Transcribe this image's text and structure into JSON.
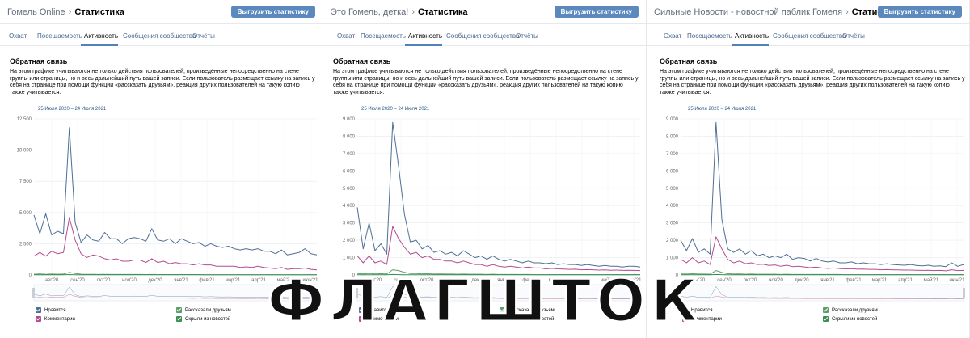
{
  "colors": {
    "likes": "#4e6f95",
    "comments": "#b44c8f",
    "reposts": "#5f9c6b",
    "hidden": "#3a8f52",
    "accent": "#5181b8",
    "button": "#5b88bd"
  },
  "panels": [
    {
      "group_name": "Гомель Online",
      "page_title": "Статистика",
      "export_label": "Выгрузить статистику",
      "tabs": [
        {
          "label": "Охват"
        },
        {
          "label": "Посещаемость"
        },
        {
          "label": "Активность"
        },
        {
          "label": "Сообщения сообщества"
        },
        {
          "label": "Отчёты"
        }
      ],
      "active_tab": 2,
      "section_title": "Обратная связь",
      "description": "На этом графике учитываются не только действия пользователей, произведённые непосредственно на стене группы или страницы, но и весь дальнейший путь вашей записи. Если пользователь размещает ссылку на запись у себя на странице при помощи функции «рассказать друзьям», реакция других пользователей на такую копию также учитывается.",
      "date_range": "25 Июля 2020 – 24 Июля 2021",
      "legend": {
        "likes": "Нравится",
        "comments": "Комментарии",
        "reposts": "Рассказали друзьям",
        "hidden": "Скрыли из новостей"
      },
      "chart_data": {
        "type": "line",
        "y_ticks": [
          "12 500",
          "10 000",
          "7 500",
          "5 000",
          "2 500",
          "0"
        ],
        "ylim": [
          0,
          12500
        ],
        "x_ticks": [
          "авг'20",
          "сен'20",
          "окт'20",
          "ноя'20",
          "дек'20",
          "янв'21",
          "фев'21",
          "мар'21",
          "апр'21",
          "май'21",
          "июн'21"
        ],
        "series": [
          {
            "name": "Нравится",
            "key": "likes",
            "values": [
              4800,
              3300,
              4900,
              3200,
              3500,
              3300,
              11800,
              4200,
              2600,
              3200,
              2800,
              2700,
              3400,
              2900,
              2900,
              2500,
              2900,
              3000,
              2900,
              2700,
              3700,
              2800,
              2700,
              2900,
              2500,
              2900,
              2700,
              2500,
              2600,
              2300,
              2500,
              2300,
              2200,
              2300,
              2100,
              2000,
              2100,
              2000,
              2100,
              1900,
              1900,
              1700,
              2000,
              1600,
              1700,
              1800,
              2100,
              1700,
              1600
            ]
          },
          {
            "name": "Комментарии",
            "key": "comments",
            "values": [
              1500,
              1800,
              1500,
              1900,
              1700,
              1800,
              4600,
              2800,
              1700,
              1400,
              1600,
              1500,
              1300,
              1200,
              1300,
              1100,
              1100,
              1200,
              1200,
              1000,
              1300,
              1000,
              1100,
              900,
              1000,
              900,
              900,
              800,
              900,
              800,
              800,
              700,
              700,
              700,
              700,
              600,
              650,
              600,
              700,
              600,
              550,
              500,
              600,
              450,
              500,
              500,
              550,
              450,
              400
            ]
          },
          {
            "name": "Рассказали друзьям",
            "key": "reposts",
            "values": [
              60,
              80,
              50,
              70,
              60,
              70,
              200,
              120,
              60,
              50,
              50,
              40,
              50,
              40,
              40,
              40,
              40,
              40,
              40,
              30,
              40,
              30,
              30,
              30,
              30,
              30,
              30,
              30,
              30,
              20,
              20,
              20,
              20,
              20,
              20,
              20,
              20,
              20,
              20,
              20,
              20,
              20,
              20,
              20,
              20,
              20,
              20,
              20,
              20
            ]
          },
          {
            "name": "Скрыли из новостей",
            "key": "hidden",
            "values": [
              10,
              10,
              10,
              10,
              10,
              10,
              30,
              20,
              10,
              10,
              10,
              10,
              10,
              10,
              10,
              10,
              10,
              10,
              10,
              10,
              10,
              10,
              10,
              10,
              10,
              10,
              10,
              10,
              10,
              10,
              10,
              10,
              10,
              10,
              10,
              10,
              10,
              10,
              10,
              10,
              10,
              10,
              10,
              10,
              10,
              10,
              10,
              10,
              10
            ]
          }
        ]
      }
    },
    {
      "group_name": "Это Гомель, детка!",
      "page_title": "Статистика",
      "export_label": "Выгрузить статистику",
      "tabs": [
        {
          "label": "Охват"
        },
        {
          "label": "Посещаемость"
        },
        {
          "label": "Активность"
        },
        {
          "label": "Сообщения сообщества"
        },
        {
          "label": "Отчёты"
        }
      ],
      "active_tab": 2,
      "section_title": "Обратная связь",
      "description": "На этом графике учитываются не только действия пользователей, произведённые непосредственно на стене группы или страницы, но и весь дальнейший путь вашей записи. Если пользователь размещает ссылку на запись у себя на странице при помощи функции «рассказать друзьям», реакция других пользователей на такую копию также учитывается.",
      "date_range": "25 Июля 2020 – 24 Июля 2021",
      "legend": {
        "likes": "Нравится",
        "comments": "Комментарии",
        "reposts": "Рассказали друзьям",
        "hidden": "Скрыли из новостей"
      },
      "chart_data": {
        "type": "line",
        "y_ticks": [
          "9 000",
          "8 000",
          "7 000",
          "6 000",
          "5 000",
          "4 000",
          "3 000",
          "2 000",
          "1 000",
          "0"
        ],
        "ylim": [
          0,
          9000
        ],
        "x_ticks": [
          "авг'20",
          "сен'20",
          "окт'20",
          "ноя'20",
          "дек'20",
          "янв'21",
          "фев'21",
          "мар'21",
          "апр'21",
          "май'21",
          "июн'21"
        ],
        "series": [
          {
            "name": "Нравится",
            "key": "likes",
            "values": [
              3900,
              1500,
              3000,
              1400,
              1800,
              1200,
              8800,
              6300,
              3500,
              1900,
              2000,
              1500,
              1700,
              1300,
              1400,
              1200,
              1300,
              1100,
              1400,
              1200,
              1000,
              1100,
              900,
              1100,
              900,
              800,
              900,
              800,
              700,
              800,
              700,
              700,
              650,
              700,
              600,
              650,
              600,
              600,
              550,
              600,
              550,
              500,
              550,
              500,
              500,
              450,
              500,
              500,
              450
            ]
          },
          {
            "name": "Комментарии",
            "key": "comments",
            "values": [
              1100,
              700,
              1100,
              700,
              800,
              600,
              2800,
              2100,
              1600,
              1200,
              1300,
              1000,
              1100,
              900,
              900,
              800,
              800,
              700,
              800,
              700,
              600,
              600,
              500,
              600,
              500,
              450,
              500,
              450,
              400,
              450,
              400,
              400,
              350,
              380,
              350,
              340,
              320,
              330,
              300,
              310,
              300,
              280,
              290,
              270,
              280,
              260,
              270,
              260,
              250
            ]
          },
          {
            "name": "Рассказали друзьям",
            "key": "reposts",
            "values": [
              80,
              60,
              90,
              60,
              70,
              50,
              300,
              250,
              150,
              80,
              80,
              60,
              70,
              50,
              60,
              50,
              50,
              40,
              50,
              40,
              40,
              40,
              30,
              40,
              30,
              30,
              30,
              30,
              30,
              30,
              20,
              20,
              20,
              20,
              20,
              20,
              20,
              20,
              20,
              20,
              20,
              20,
              20,
              20,
              20,
              20,
              20,
              20,
              20
            ]
          },
          {
            "name": "Скрыли из новостей",
            "key": "hidden",
            "values": [
              10,
              10,
              10,
              10,
              10,
              10,
              30,
              20,
              10,
              10,
              10,
              10,
              10,
              10,
              10,
              10,
              10,
              10,
              10,
              10,
              10,
              10,
              10,
              10,
              10,
              10,
              10,
              10,
              10,
              10,
              10,
              10,
              10,
              10,
              10,
              10,
              10,
              10,
              10,
              10,
              10,
              10,
              10,
              10,
              10,
              10,
              10,
              10,
              10
            ]
          }
        ]
      }
    },
    {
      "group_name": "Сильные Новости - новостной паблик Гомеля",
      "page_title": "Статистика",
      "export_label": "Выгрузить статистику",
      "tabs": [
        {
          "label": "Охват"
        },
        {
          "label": "Посещаемость"
        },
        {
          "label": "Активность"
        },
        {
          "label": "Сообщения сообщества"
        },
        {
          "label": "Отчёты"
        }
      ],
      "active_tab": 2,
      "section_title": "Обратная связь",
      "description": "На этом графике учитываются не только действия пользователей, произведённые непосредственно на стене группы или страницы, но и весь дальнейший путь вашей записи. Если пользователь размещает ссылку на запись у себя на странице при помощи функции «рассказать друзьям», реакция других пользователей на такую копию также учитывается.",
      "date_range": "25 Июля 2020 – 24 Июля 2021",
      "legend": {
        "likes": "Нравится",
        "comments": "Комментарии",
        "reposts": "Рассказали друзьям",
        "hidden": "Скрыли из новостей"
      },
      "chart_data": {
        "type": "line",
        "y_ticks": [
          "9 000",
          "8 000",
          "7 000",
          "6 000",
          "5 000",
          "4 000",
          "3 000",
          "2 000",
          "1 000",
          "0"
        ],
        "ylim": [
          0,
          9000
        ],
        "x_ticks": [
          "авг'20",
          "сен'20",
          "окт'20",
          "ноя'20",
          "дек'20",
          "янв'21",
          "фев'21",
          "мар'21",
          "апр'21",
          "май'21",
          "июн'21"
        ],
        "series": [
          {
            "name": "Нравится",
            "key": "likes",
            "values": [
              2000,
              1400,
              2100,
              1300,
              1500,
              1200,
              8800,
              3200,
              1500,
              1300,
              1500,
              1200,
              1400,
              1100,
              1200,
              1000,
              1100,
              1000,
              1200,
              900,
              1000,
              950,
              800,
              950,
              800,
              750,
              800,
              700,
              700,
              750,
              650,
              700,
              650,
              650,
              600,
              650,
              600,
              580,
              560,
              600,
              550,
              520,
              560,
              500,
              520,
              480,
              700,
              500,
              600
            ]
          },
          {
            "name": "Комментарии",
            "key": "comments",
            "values": [
              900,
              700,
              1000,
              700,
              800,
              600,
              2200,
              1500,
              900,
              700,
              800,
              650,
              700,
              600,
              620,
              550,
              580,
              500,
              560,
              480,
              500,
              460,
              420,
              450,
              400,
              380,
              400,
              370,
              350,
              360,
              330,
              340,
              320,
              320,
              300,
              310,
              290,
              290,
              280,
              280,
              270,
              260,
              270,
              250,
              260,
              240,
              300,
              250,
              260
            ]
          },
          {
            "name": "Рассказали друзьям",
            "key": "reposts",
            "values": [
              60,
              50,
              70,
              50,
              50,
              40,
              250,
              150,
              70,
              50,
              60,
              40,
              50,
              40,
              40,
              40,
              40,
              30,
              40,
              30,
              30,
              30,
              30,
              30,
              30,
              30,
              30,
              30,
              20,
              20,
              20,
              20,
              20,
              20,
              20,
              20,
              20,
              20,
              20,
              20,
              20,
              20,
              20,
              20,
              20,
              20,
              20,
              20,
              20
            ]
          },
          {
            "name": "Скрыли из новостей",
            "key": "hidden",
            "values": [
              10,
              10,
              10,
              10,
              10,
              10,
              30,
              20,
              10,
              10,
              10,
              10,
              10,
              10,
              10,
              10,
              10,
              10,
              10,
              10,
              10,
              10,
              10,
              10,
              10,
              10,
              10,
              10,
              10,
              10,
              10,
              10,
              10,
              10,
              10,
              10,
              10,
              10,
              10,
              10,
              10,
              10,
              10,
              10,
              10,
              10,
              10,
              10,
              10
            ]
          }
        ]
      }
    }
  ],
  "watermark": {
    "text": "ФЛАГШТОК"
  }
}
